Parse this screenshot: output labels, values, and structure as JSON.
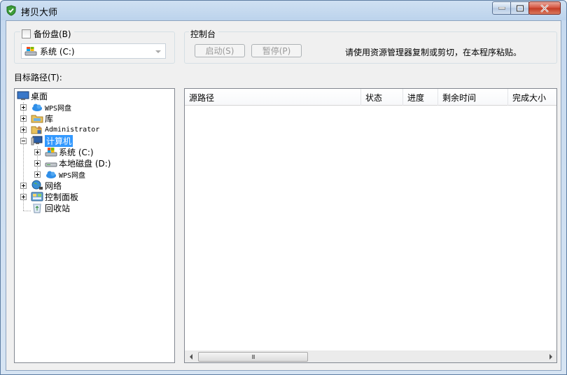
{
  "window": {
    "title": "拷贝大师",
    "minimize_icon": "minimize-icon",
    "maximize_icon": "maximize-icon",
    "close_icon": "close-icon"
  },
  "backup": {
    "checkbox_label": "备份盘(B)",
    "checked": false,
    "selected_drive": "系统 (C:)"
  },
  "console": {
    "label": "控制台",
    "start_button": "启动(S)",
    "pause_button": "暂停(P)",
    "hint": "请使用资源管理器复制或剪切，在本程序粘贴。"
  },
  "target": {
    "label": "目标路径(T):"
  },
  "tree": {
    "items": [
      {
        "label": "桌面",
        "icon": "desktop-icon"
      },
      {
        "label": "WPS网盘",
        "icon": "cloud-icon"
      },
      {
        "label": "库",
        "icon": "library-icon"
      },
      {
        "label": "Administrator",
        "icon": "user-folder-icon"
      },
      {
        "label": "计算机",
        "icon": "computer-icon"
      },
      {
        "label": "系统 (C:)",
        "icon": "system-drive-icon"
      },
      {
        "label": "本地磁盘 (D:)",
        "icon": "drive-icon"
      },
      {
        "label": "WPS网盘",
        "icon": "cloud-icon"
      },
      {
        "label": "网络",
        "icon": "network-icon"
      },
      {
        "label": "控制面板",
        "icon": "control-panel-icon"
      },
      {
        "label": "回收站",
        "icon": "recycle-bin-icon"
      }
    ]
  },
  "list": {
    "columns": [
      "源路径",
      "状态",
      "进度",
      "剩余时间",
      "完成大小"
    ],
    "rows": [],
    "scrollbar_thumb_glyph": "III"
  },
  "colors": {
    "selection": "#3399ff",
    "window_frame": "#bcd3ec",
    "close_button": "#c23a23"
  }
}
